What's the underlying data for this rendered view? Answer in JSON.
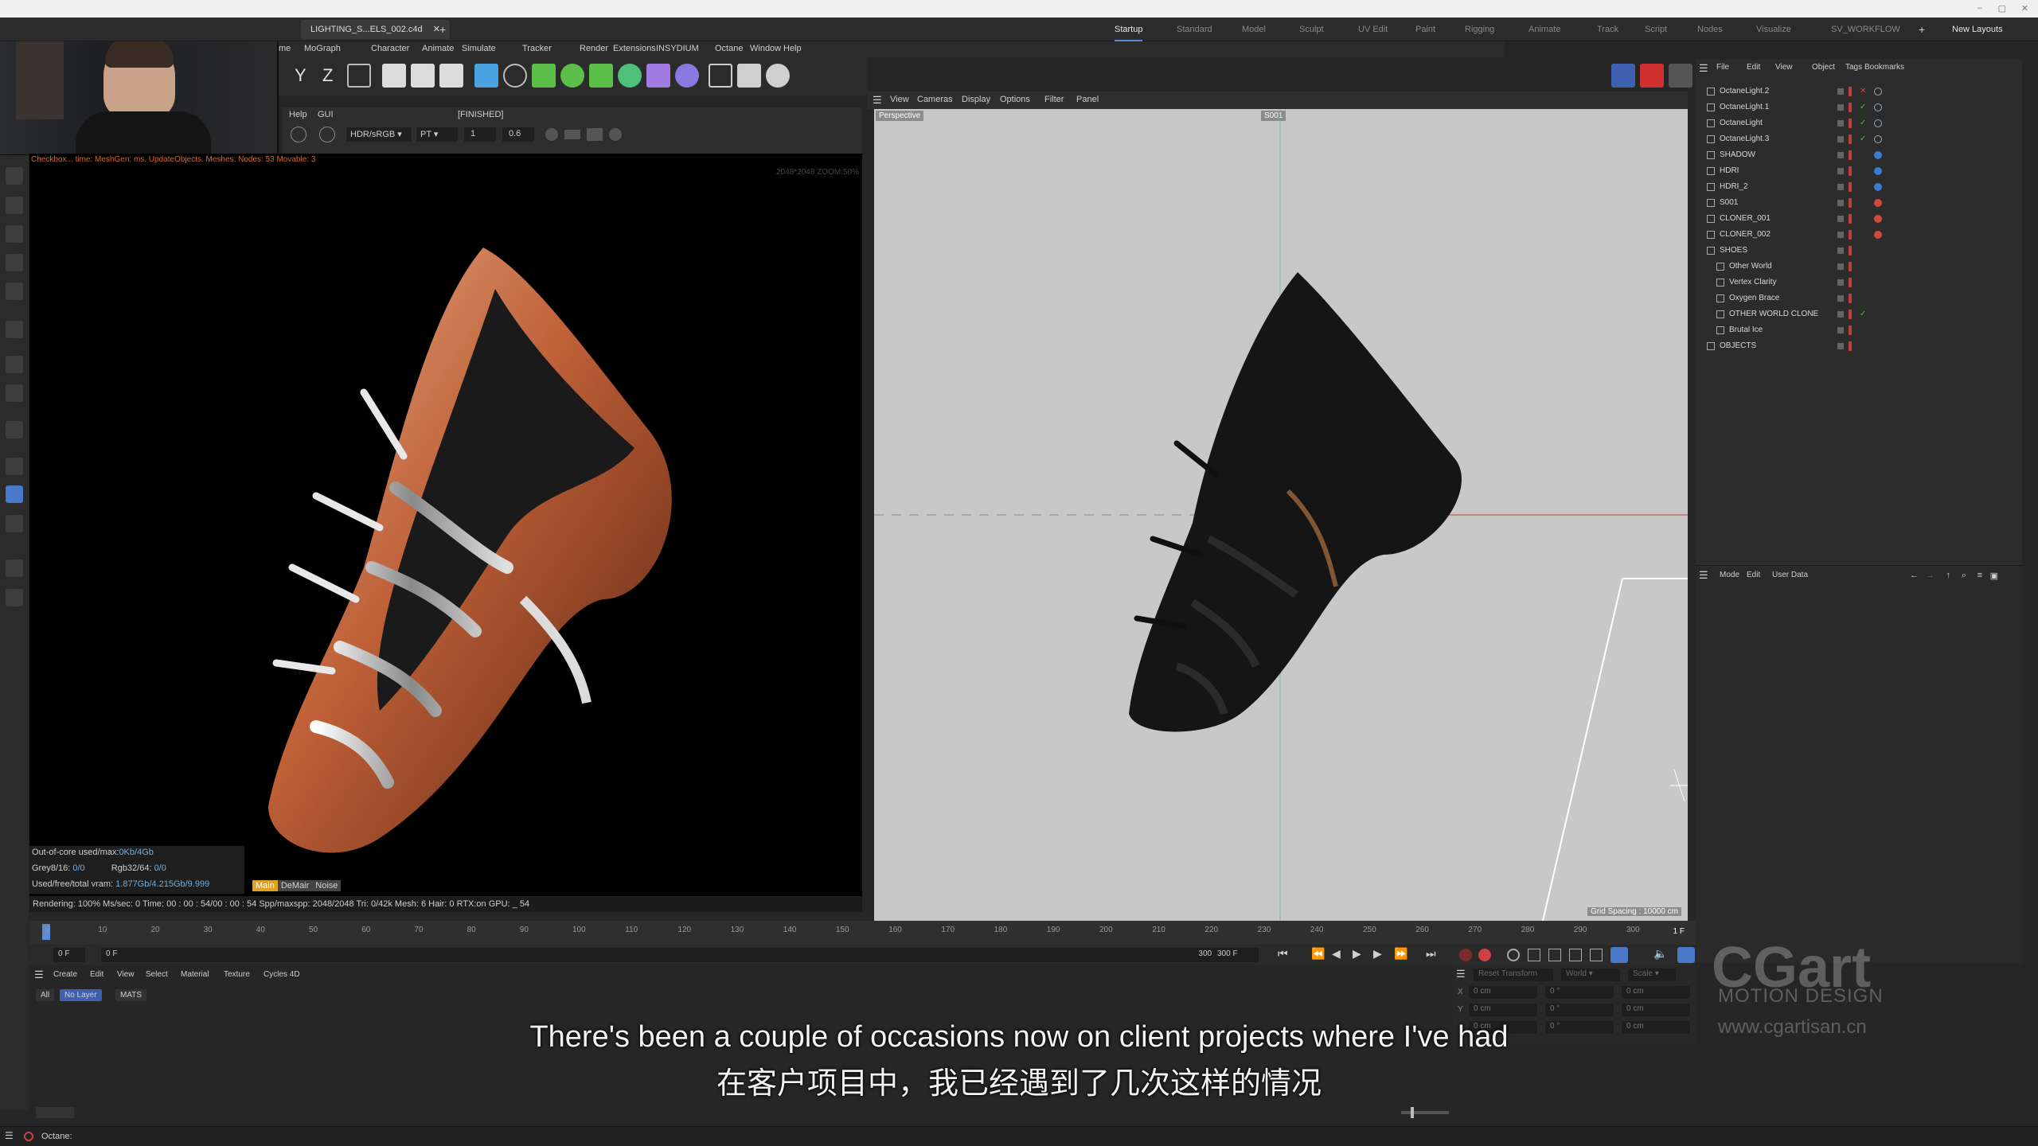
{
  "window": {
    "file_tab": "LIGHTING_S...ELS_002.c4d",
    "layouts": [
      "Startup",
      "Standard",
      "Model",
      "Sculpt",
      "UV Edit",
      "Paint",
      "Rigging",
      "Animate",
      "Track",
      "Script",
      "Nodes",
      "Visualize",
      "SV_WORKFLOW"
    ],
    "active_layout": "Startup",
    "new_layouts": "New Layouts"
  },
  "main_menu": [
    "me",
    "MoGraph",
    "Character",
    "Animate",
    "Simulate",
    "Tracker",
    "Render",
    "Extensions",
    "INSYDIUM",
    "Octane",
    "Window",
    "Help"
  ],
  "toolbar": {
    "axis_y": "Y",
    "axis_z": "Z"
  },
  "render_panel": {
    "help": "Help",
    "gui": "GUI",
    "status": "[FINISHED]",
    "colorspace": "HDR/sRGB",
    "kernel": "PT",
    "field_a": "1",
    "field_b": "0.6",
    "log_line": "Checkbox... time: MeshGen: ms. UpdateObjects. Meshes: Nodes: 53 Movable: 3",
    "resolution": "2048*2048 ZOOM:50%",
    "stats": {
      "out_of_core_label": "Out-of-core used/max:",
      "out_of_core_value": "0Kb/4Gb",
      "grey_label": "Grey8/16:",
      "grey_value": "0/0",
      "rgb_label": "Rgb32/64:",
      "rgb_value": "0/0",
      "vram_label": "Used/free/total vram:",
      "vram_value": "1.877Gb/4.215Gb/9.999",
      "main_btn": "Main",
      "demair_btn": "DeMair",
      "noise_btn": "Noise",
      "rendering": "Rendering: 100%  Ms/sec: 0    Time: 00 : 00 : 54/00 : 00 : 54   Spp/maxspp: 2048/2048    Tri: 0/42k    Mesh: 6  Hair: 0    RTX:on       GPU: _     54"
    }
  },
  "viewport": {
    "menu": [
      "View",
      "Cameras",
      "Display",
      "Options",
      "Filter",
      "Panel"
    ],
    "label": "Perspective",
    "camera_tag": "S001",
    "grid_spacing": "Grid Spacing : 10000 cm"
  },
  "object_manager": {
    "menu": [
      "File",
      "Edit",
      "View",
      "Object",
      "Tags",
      "Bookmarks"
    ],
    "objects": [
      {
        "name": "OctaneLight.2",
        "status": "x"
      },
      {
        "name": "OctaneLight.1",
        "status": "check"
      },
      {
        "name": "OctaneLight",
        "status": "check"
      },
      {
        "name": "OctaneLight.3",
        "status": "check"
      },
      {
        "name": "SHADOW",
        "status": ""
      },
      {
        "name": "HDRI",
        "status": ""
      },
      {
        "name": "HDRI_2",
        "status": ""
      },
      {
        "name": "S001",
        "status": ""
      },
      {
        "name": "CLONER_001",
        "status": ""
      },
      {
        "name": "CLONER_002",
        "status": ""
      },
      {
        "name": "SHOES",
        "status": ""
      },
      {
        "name": "Other World",
        "status": ""
      },
      {
        "name": "Vertex Clarity",
        "status": ""
      },
      {
        "name": "Oxygen Brace",
        "status": ""
      },
      {
        "name": "OTHER WORLD CLONE",
        "status": "check"
      },
      {
        "name": "Brutal Ice",
        "status": ""
      },
      {
        "name": "OBJECTS",
        "status": ""
      }
    ]
  },
  "attributes": {
    "menu": [
      "Mode",
      "Edit",
      "User Data"
    ]
  },
  "timeline": {
    "ticks": [
      "0",
      "10",
      "20",
      "30",
      "40",
      "50",
      "60",
      "70",
      "80",
      "90",
      "100",
      "110",
      "120",
      "130",
      "140",
      "150",
      "160",
      "170",
      "180",
      "190",
      "200",
      "210",
      "220",
      "230",
      "240",
      "250",
      "260",
      "270",
      "280",
      "290",
      "300"
    ],
    "current_frame": "1 F",
    "start_field": "0 F",
    "start_field2": "0 F",
    "end_label": "300 F",
    "end_field": "300 F"
  },
  "material_manager": {
    "menu": [
      "Create",
      "Edit",
      "View",
      "Select",
      "Material",
      "Texture",
      "Cycles 4D"
    ],
    "filters": [
      "All",
      "No Layer",
      "MATS"
    ],
    "active_filter": "No Layer"
  },
  "coordinates": {
    "reset": "Reset Transform",
    "world": "World",
    "scale": "Scale",
    "rows": [
      {
        "axis": "X",
        "pos": "0 cm",
        "rot": "0 °",
        "size": "0 cm"
      },
      {
        "axis": "Y",
        "pos": "0 cm",
        "rot": "0 °",
        "size": "0 cm"
      },
      {
        "axis": "",
        "pos": "0 cm",
        "rot": "0 °",
        "size": "0 cm"
      }
    ]
  },
  "status_bar": "Octane:",
  "subtitles": {
    "en": "There's been a couple of occasions now on client projects where I've had",
    "zh": "在客户项目中，我已经遇到了几次这样的情况"
  },
  "watermark": {
    "brand": "CGart",
    "tagline": "MOTION DESIGN",
    "url": "www.cgartisan.cn"
  },
  "colors": {
    "accent": "#5b8ad6",
    "copper": "#c8643a",
    "render_bg": "#000000",
    "viewport_bg": "#c8c8c8",
    "ui_bg": "#262626"
  }
}
